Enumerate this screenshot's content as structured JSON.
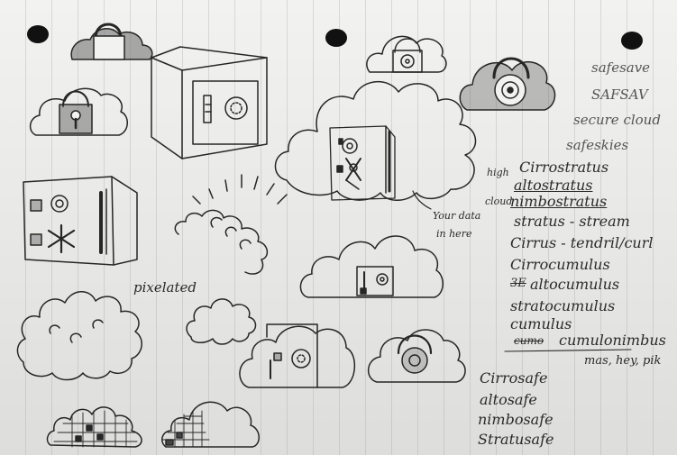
{
  "names_top": [
    "safesave",
    "SAFSAV",
    "secure cloud",
    "safeskies"
  ],
  "cloud_types": {
    "high_label": "high",
    "cloud_label": "cloud",
    "cirrostratus": "Cirrostratus",
    "altostratus": "altostratus",
    "nimbostratus": "nimbostratus",
    "stratus": "stratus - stream",
    "cirrus": "Cirrus - tendril/curl",
    "cirrocumulus": "Cirrocumulus",
    "altocumulus_strike": "3E",
    "altocumulus": "altocumulus",
    "stratocumulus": "stratocumulus",
    "cumulus": "cumulus",
    "cumulonimbus_strike": "cumo",
    "cumulonimbus": "cumulonimbus",
    "note": "mas, hey, pik"
  },
  "names_bottom": [
    "Cirrosafe",
    "altosafe",
    "nimbosafe",
    "Stratusafe"
  ],
  "annotations": {
    "pixelated": "pixelated",
    "your_data": "Your data",
    "in_here": "in here"
  }
}
